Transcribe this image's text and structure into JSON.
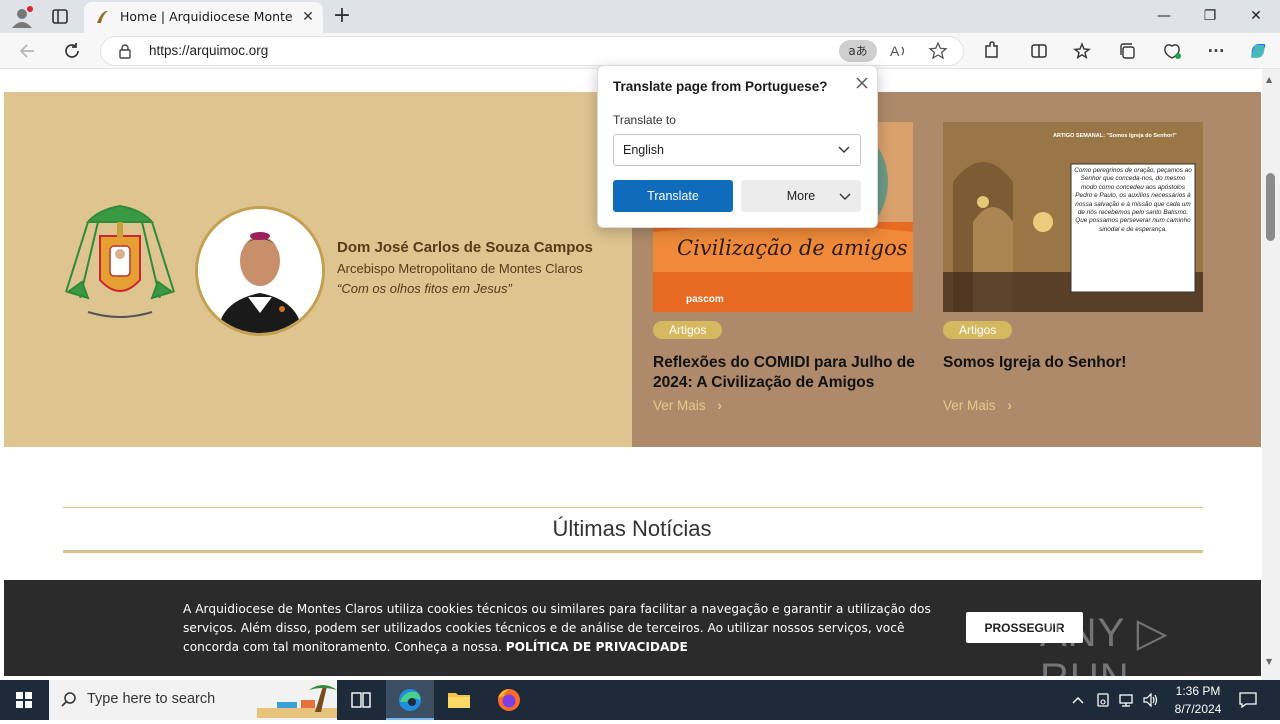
{
  "browser": {
    "tab_title": "Home | Arquidiocese Montes Claros",
    "tab_close": "✕",
    "new_tab": "+",
    "url": "https://arquimoc.org",
    "minimize": "—",
    "restore": "❐",
    "close": "✕",
    "more_tools": "···",
    "translate_badge": "aあ"
  },
  "translate_popup": {
    "title": "Translate page from Portuguese?",
    "label": "Translate to",
    "selected_language": "English",
    "translate_button": "Translate",
    "more_button": "More"
  },
  "banner": {
    "bishop_name": "Dom José Carlos de Souza Campos",
    "bishop_role": "Arcebispo Metropolitano de Montes Claros",
    "bishop_motto": "“Com os olhos fitos em Jesus”"
  },
  "cards": [
    {
      "tag": "Artigos",
      "title": "Reflexões do COMIDI para Julho de 2024: A Civilização de Amigos",
      "link": "Ver Mais",
      "image_caption": "Civilização de amigos",
      "image_footer": "pascom"
    },
    {
      "tag": "Artigos",
      "title": "Somos Igreja do Senhor!",
      "link": "Ver Mais",
      "image_header": "ARTIGO SEMANAL: \"Somos Igreja do Senhor!\"",
      "image_quote": "Como peregrinos de oração, peçamos ao Senhor que conceda-nos, do mesmo modo como concedeu aos apóstolos Pedro e Paulo, os auxílios necessários à nossa salvação e à missão que cada um de nós recebemos pelo santo Batismo. Que possamos perseverar num caminho sinodal e de esperança."
    }
  ],
  "news": {
    "heading": "Últimas Notícias"
  },
  "cookie": {
    "text": "A Arquidiocese de Montes Claros utiliza cookies técnicos ou similares para facilitar a navegação e garantir a utilização dos serviços. Além disso, podem ser utilizados cookies técnicos e de análise de terceiros. Ao utilizar nossos serviços, você concorda com tal monitoramento. Conheça a nossa. ",
    "policy_link": "POLÍTICA DE PRIVACIDADE",
    "button": "PROSSEGUIR",
    "watermark": "ANY ▷ RUN"
  },
  "taskbar": {
    "search_placeholder": "Type here to search",
    "time": "1:36 PM",
    "date": "8/7/2024"
  },
  "colors": {
    "banner_left": "#dec48f",
    "banner_right": "#ae8a6a",
    "accent_gold": "#d5b860",
    "translate_blue": "#0f6cbd"
  }
}
